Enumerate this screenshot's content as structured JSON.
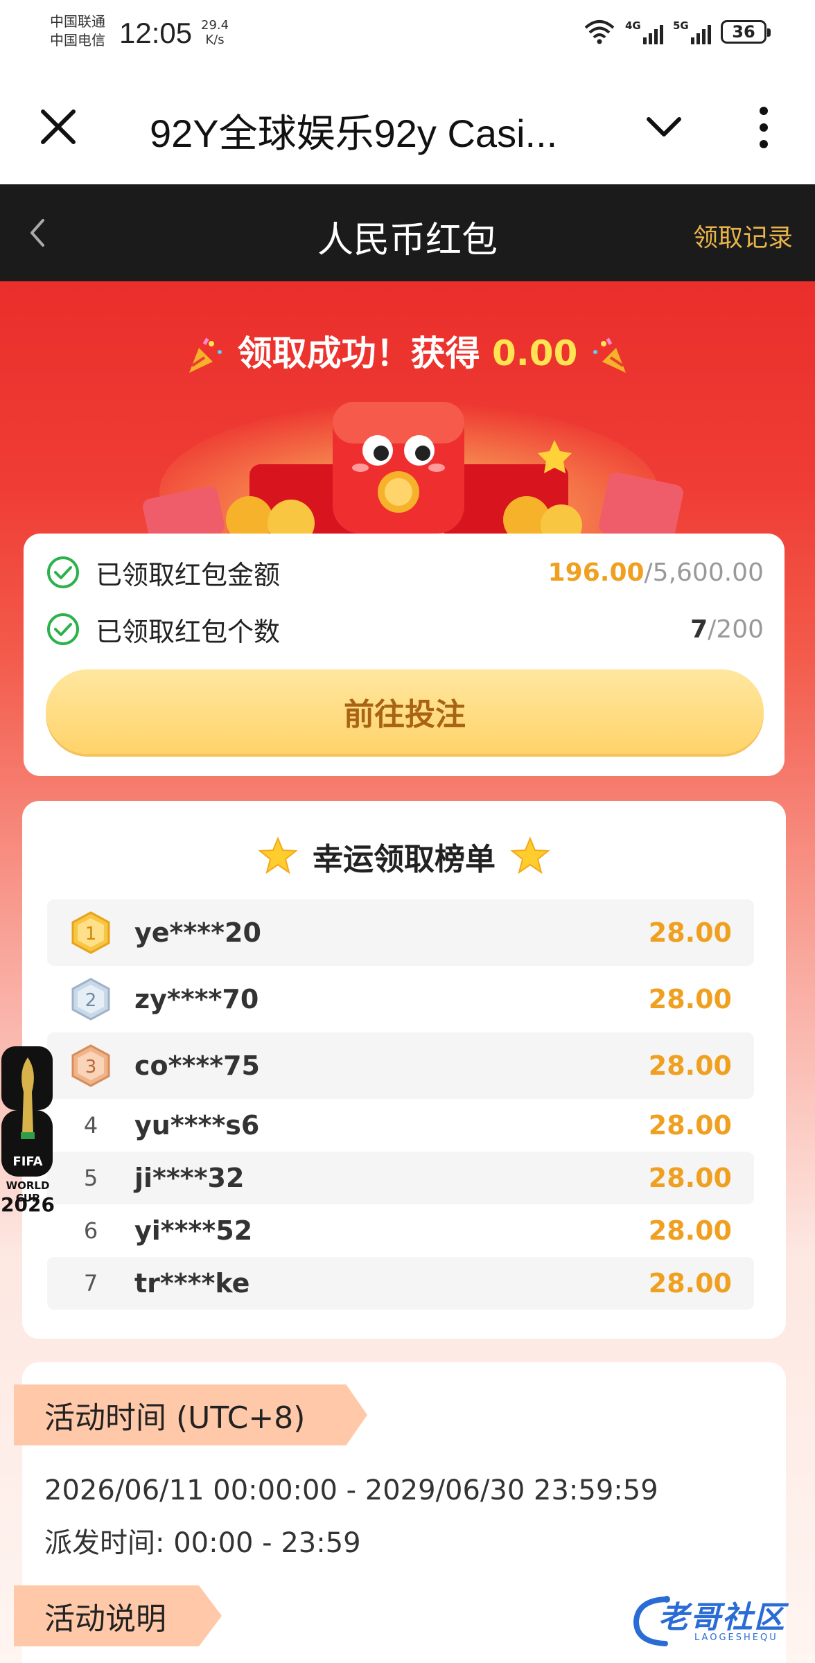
{
  "status_bar": {
    "carrier1": "中国联通",
    "carrier2": "中国电信",
    "time": "12:05",
    "speed_value": "29.4",
    "speed_unit": "K/s",
    "signal1": "4G",
    "signal2": "5G",
    "battery": "36"
  },
  "browser": {
    "title": "92Y全球娱乐92y Casi..."
  },
  "header": {
    "title": "人民币红包",
    "record_link": "领取记录"
  },
  "hero": {
    "success_text": "领取成功！获得",
    "amount": "0.00"
  },
  "summary": {
    "amount_label": "已领取红包金额",
    "amount_current": "196.00",
    "amount_total": "/5,600.00",
    "count_label": "已领取红包个数",
    "count_current": "7",
    "count_total": "/200",
    "bet_button": "前往投注"
  },
  "leaderboard": {
    "title": "幸运领取榜单",
    "rows": [
      {
        "rank": "1",
        "user": "ye****20",
        "amount": "28.00"
      },
      {
        "rank": "2",
        "user": "zy****70",
        "amount": "28.00"
      },
      {
        "rank": "3",
        "user": "co****75",
        "amount": "28.00"
      },
      {
        "rank": "4",
        "user": "yu****s6",
        "amount": "28.00"
      },
      {
        "rank": "5",
        "user": "ji****32",
        "amount": "28.00"
      },
      {
        "rank": "6",
        "user": "yi****52",
        "amount": "28.00"
      },
      {
        "rank": "7",
        "user": "tr****ke",
        "amount": "28.00"
      }
    ]
  },
  "activity": {
    "time_tag": "活动时间 (UTC+8)",
    "period": "2026/06/11 00:00:00 - 2029/06/30 23:59:59",
    "dispatch": "派发时间: 00:00 - 23:59",
    "desc_tag": "活动说明"
  },
  "badge": {
    "line1": "FIFA",
    "line2": "WORLD CUP",
    "year": "2026"
  },
  "watermark": {
    "main": "老哥社区",
    "sub": "LAOGESHEQU"
  },
  "colors": {
    "accent_gold": "#f0a020",
    "header_bg": "#1b1b1b",
    "hero_red": "#ea2e2b",
    "record_gold": "#e9b54a"
  }
}
